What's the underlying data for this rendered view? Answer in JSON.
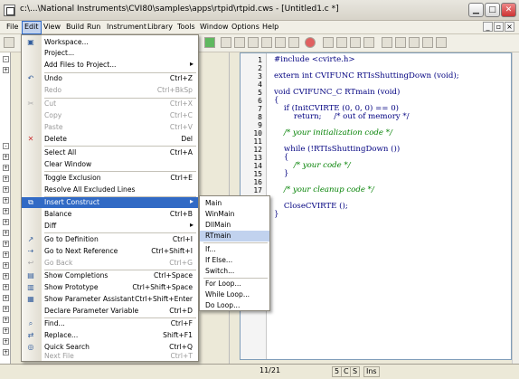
{
  "window": {
    "title": "c:\\...\\National Instruments\\CVI80\\samples\\apps\\rtpid\\rtpid.cws - [Untitled1.c *]"
  },
  "menubar": [
    "File",
    "Edit",
    "View",
    "Build",
    "Run",
    "Instrument",
    "Library",
    "Tools",
    "Window",
    "Options",
    "Help"
  ],
  "edit_menu": [
    {
      "label": "Workspace...",
      "shortcut": "",
      "icon": "workspace-icon"
    },
    {
      "label": "Project...",
      "shortcut": ""
    },
    {
      "label": "Add Files to Project...",
      "shortcut": "▸"
    },
    {
      "label": "Undo",
      "shortcut": "Ctrl+Z",
      "icon": "undo-icon"
    },
    {
      "label": "Redo",
      "shortcut": "Ctrl+BkSp",
      "disabled": true
    },
    {
      "label": "Cut",
      "shortcut": "Ctrl+X",
      "disabled": true,
      "icon": "cut-icon"
    },
    {
      "label": "Copy",
      "shortcut": "Ctrl+C",
      "disabled": true
    },
    {
      "label": "Paste",
      "shortcut": "Ctrl+V",
      "disabled": true
    },
    {
      "label": "Delete",
      "shortcut": "Del",
      "icon": "delete-icon"
    },
    {
      "label": "Select All",
      "shortcut": "Ctrl+A"
    },
    {
      "label": "Clear Window",
      "shortcut": ""
    },
    {
      "label": "Toggle Exclusion",
      "shortcut": "Ctrl+E"
    },
    {
      "label": "Resolve All Excluded Lines",
      "shortcut": ""
    },
    {
      "label": "Insert Construct",
      "shortcut": "▸",
      "highlight": true
    },
    {
      "label": "Balance",
      "shortcut": "Ctrl+B"
    },
    {
      "label": "Diff",
      "shortcut": "▸"
    },
    {
      "label": "Go to Definition",
      "shortcut": "Ctrl+I"
    },
    {
      "label": "Go to Next Reference",
      "shortcut": "Ctrl+Shift+I"
    },
    {
      "label": "Go Back",
      "shortcut": "Ctrl+G",
      "disabled": true
    },
    {
      "label": "Show Completions",
      "shortcut": "Ctrl+Space"
    },
    {
      "label": "Show Prototype",
      "shortcut": "Ctrl+Shift+Space"
    },
    {
      "label": "Show Parameter Assistant",
      "shortcut": "Ctrl+Shift+Enter"
    },
    {
      "label": "Declare Parameter Variable",
      "shortcut": "Ctrl+D"
    },
    {
      "label": "Find...",
      "shortcut": "Ctrl+F"
    },
    {
      "label": "Replace...",
      "shortcut": "Shift+F1"
    },
    {
      "label": "Quick Search",
      "shortcut": "Ctrl+Q"
    },
    {
      "label": "Next File",
      "shortcut": "Ctrl+T",
      "disabled": true
    }
  ],
  "submenu": [
    "Main",
    "WinMain",
    "DllMain",
    "RTmain",
    "If...",
    "If Else...",
    "Switch...",
    "For Loop...",
    "While Loop...",
    "Do Loop..."
  ],
  "code": {
    "lines": [
      "1",
      "2",
      "3",
      "4",
      "5",
      "6",
      "7",
      "8",
      "9",
      "10",
      "11",
      "12",
      "13",
      "14",
      "15",
      "16",
      "17",
      "18"
    ],
    "text": [
      "#include <cvirte.h>",
      "",
      "extern int CVIFUNC RTIsShuttingDown (void);",
      "",
      "void CVIFUNC_C RTmain (void)",
      "{",
      "    if (InitCVIRTE (0, 0, 0) == 0)",
      "        return;     /* out of memory */",
      "",
      "    /* your initialization code */",
      "",
      "    while (!RTIsShuttingDown ())",
      "    {",
      "        /* your code */",
      "    }",
      "",
      "    /* your cleanup code */",
      "",
      "    CloseCVIRTE ();",
      "}"
    ]
  },
  "status": {
    "position": "11/21",
    "col": "5",
    "mode1": "C",
    "mode2": "S",
    "ins": "Ins"
  }
}
